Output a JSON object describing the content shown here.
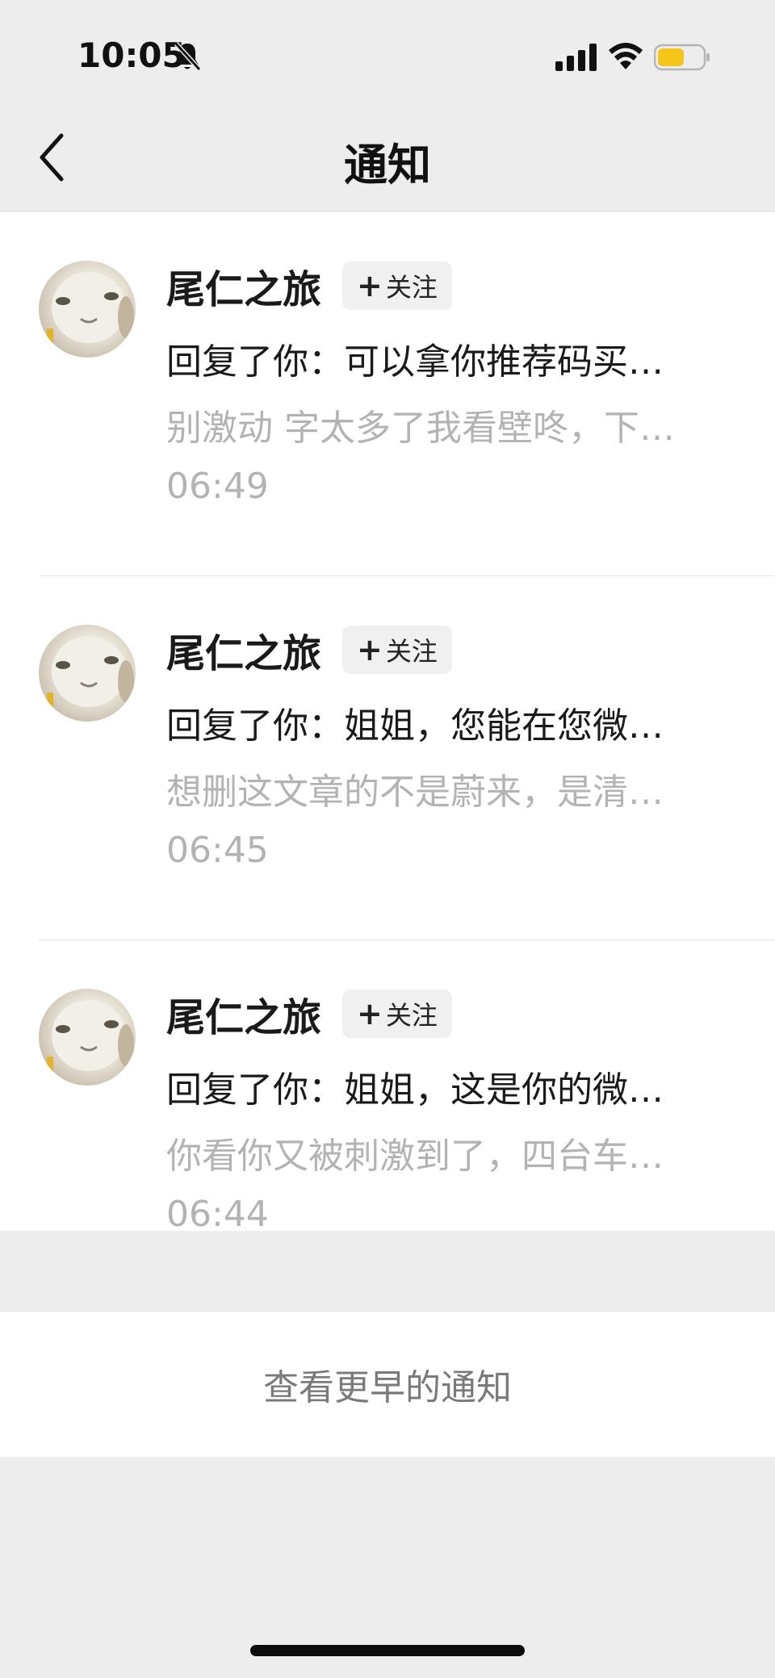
{
  "status_bar": {
    "time": "10:05",
    "battery_color": "#f5c518"
  },
  "nav": {
    "title": "通知"
  },
  "notifications": [
    {
      "username": "尾仁之旅",
      "follow_label": "关注",
      "reply": "回复了你：可以拿你推荐码买…",
      "quote": "别激动 字太多了我看壁咚，下…",
      "time": "06:49"
    },
    {
      "username": "尾仁之旅",
      "follow_label": "关注",
      "reply": "回复了你：姐姐，您能在您微…",
      "quote": "想删这文章的不是蔚来，是清…",
      "time": "06:45"
    },
    {
      "username": "尾仁之旅",
      "follow_label": "关注",
      "reply": "回复了你：姐姐，这是你的微…",
      "quote": "你看你又被刺激到了，四台车…",
      "time": "06:44"
    }
  ],
  "more_label": "查看更早的通知"
}
